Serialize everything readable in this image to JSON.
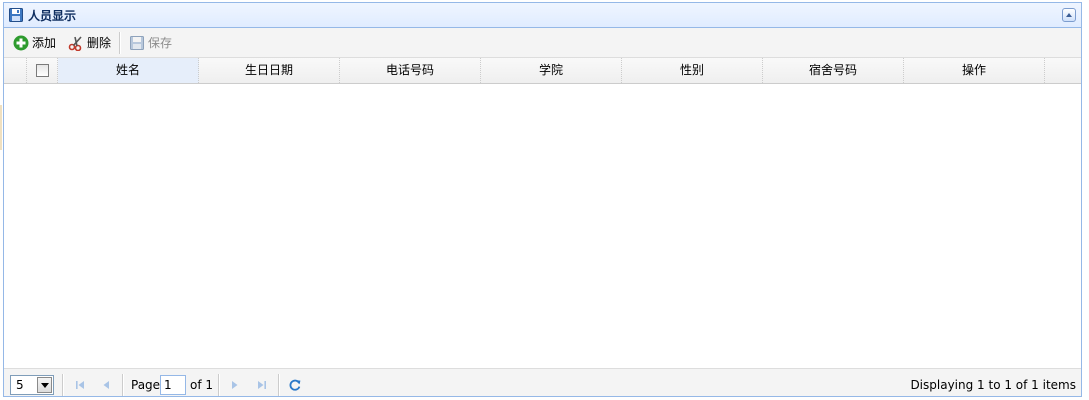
{
  "panel": {
    "title": "人员显示"
  },
  "toolbar": {
    "add_label": "添加",
    "delete_label": "删除",
    "save_label": "保存"
  },
  "grid": {
    "columns": [
      "姓名",
      "生日日期",
      "电话号码",
      "学院",
      "性别",
      "宿舍号码",
      "操作"
    ],
    "rows": []
  },
  "pager": {
    "page_size": "5",
    "page_label": "Page",
    "current_page": "1",
    "of_label": "of 1",
    "info": "Displaying 1 to 1 of 1 items"
  },
  "colors": {
    "border": "#95b8e7",
    "header_bg": "#e0ecff",
    "title_text": "#0e2d5f",
    "add_icon": "#2e9b2e",
    "delete_icon": "#c0392b",
    "nav_icon": "#2a78c8"
  }
}
